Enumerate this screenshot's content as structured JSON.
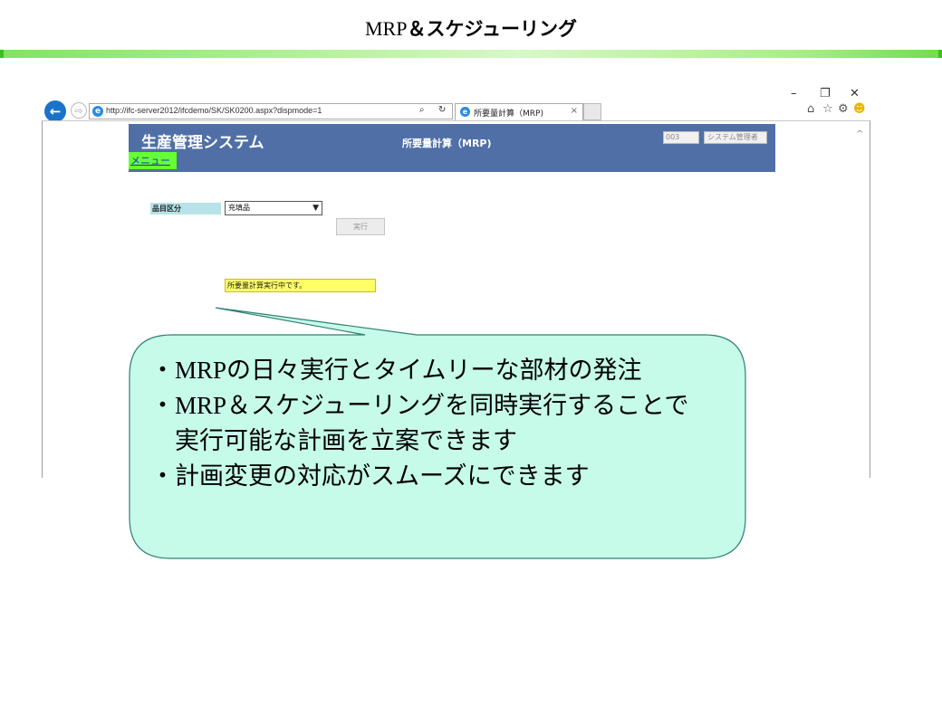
{
  "slide": {
    "title_en": "MRP",
    "title_jp": "＆スケジューリング"
  },
  "window": {
    "minimize": "–",
    "restore": "❐",
    "close": "✕"
  },
  "browser": {
    "back_icon": "←",
    "forward_icon": "⇨",
    "url": "http://ifc-server2012/ifcdemo/SK/SK0200.aspx?dispmode=1",
    "url_host": "ifc-server2012",
    "search_icon": "⌕",
    "refresh_icon": "↻",
    "tab_title": "所要量計算（MRP)",
    "tab_close": "×",
    "tools": {
      "home": "⌂",
      "favorites": "☆",
      "settings": "⚙",
      "feedback": "☻"
    },
    "scroll_up": "^"
  },
  "app": {
    "name": "生産管理システム",
    "screen_title": "所要量計算（MRP)",
    "user_code": "003",
    "user_name": "システム管理者",
    "menu_link": "メニュー",
    "form": {
      "item_category_label": "品目区分",
      "item_category_value": "充填品",
      "execute_label": "実行"
    },
    "status_message": "所要量計算実行中です。"
  },
  "callout": {
    "fill": "#c6fbe9",
    "stroke": "#2f7f74",
    "lines": [
      {
        "bullet": "・",
        "latin": "MRP",
        "text": "の日々実行とタイムリーな部材の発注"
      },
      {
        "bullet": "・",
        "latin": "MRP",
        "text": "＆スケジューリングを同時実行することで"
      },
      {
        "bullet": "",
        "latin": "",
        "text": "　実行可能な計画を立案できます"
      },
      {
        "bullet": "・",
        "latin": "",
        "text": "計画変更の対応がスムーズにできます"
      }
    ]
  },
  "colors": {
    "app_header": "#4f6fa6",
    "menu_bg": "#66ff33",
    "status_bg": "#ffff66",
    "label_bg": "#b7e3e8",
    "title_bar": "#7ee65a"
  }
}
